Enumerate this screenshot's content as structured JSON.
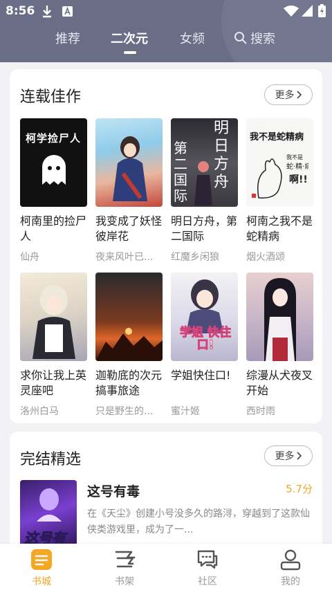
{
  "status_bar": {
    "time": "8:56"
  },
  "tabs": [
    {
      "label": "推荐"
    },
    {
      "label": "二次元"
    },
    {
      "label": "女频"
    },
    {
      "label": "搜索"
    }
  ],
  "serial_section": {
    "title": "连载佳作",
    "more_label": "更多",
    "books": [
      {
        "title": "柯南里的捡尸人",
        "author": "仙舟",
        "cover_text": "柯学捡尸人"
      },
      {
        "title": "我变成了妖怪彼岸花",
        "author": "夜来风叶已..."
      },
      {
        "title": "明日方舟，第二国际",
        "author": "红魔乡闲狼",
        "cover_text": "明日方舟 第二国际"
      },
      {
        "title": "柯南之我不是蛇精病",
        "author": "烟火酒颂",
        "cover_text": "我不是蛇精病"
      },
      {
        "title": "求你让我上英灵座吧",
        "author": "洛州白马"
      },
      {
        "title": "迦勒底的次元搞事旅途",
        "author": "只是野生的..."
      },
      {
        "title": "学姐快住口!",
        "author": "蜜汁姬",
        "cover_text": "学姐 快住口!"
      },
      {
        "title": "综漫从犬夜叉开始",
        "author": "西时雨"
      }
    ]
  },
  "finished_section": {
    "title": "完结精选",
    "more_label": "更多",
    "book": {
      "title": "这号有毒",
      "score": "5.7分",
      "description": "在《天尘》创建小号没多久的路浔，穿越到了这款仙侠类游戏里，成为了一...",
      "cover_text": "这号有毒"
    }
  },
  "bottom_nav": [
    {
      "label": "书城",
      "icon": "bookstore-icon",
      "active": true
    },
    {
      "label": "书架",
      "icon": "bookshelf-icon"
    },
    {
      "label": "社区",
      "icon": "community-icon"
    },
    {
      "label": "我的",
      "icon": "profile-icon"
    }
  ],
  "colors": {
    "header": "#6a6d86",
    "accent": "#f5a623",
    "score": "#f3a623"
  }
}
